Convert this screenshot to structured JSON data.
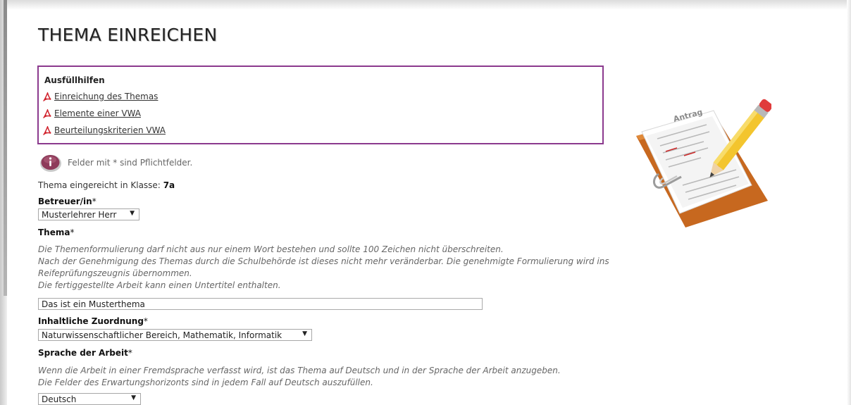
{
  "page": {
    "title": "THEMA EINREICHEN"
  },
  "help": {
    "title": "Ausfüllhilfen",
    "links": [
      "Einreichung des Themas",
      "Elemente einer VWA",
      "Beurteilungskriterien VWA"
    ]
  },
  "info": {
    "text": "Felder mit * sind Pflichtfelder.",
    "icon": "info-icon"
  },
  "klasse": {
    "label": "Thema eingereicht in Klasse:",
    "value": "7a"
  },
  "fields": {
    "betreuer": {
      "label": "Betreuer/in",
      "required_mark": "*",
      "value": "Musterlehrer Herr"
    },
    "thema": {
      "label": "Thema",
      "required_mark": "*",
      "hint_lines": [
        "Die Themenformulierung darf nicht aus nur einem Wort bestehen und sollte 100 Zeichen nicht überschreiten.",
        "Nach der Genehmigung des Themas durch die Schulbehörde ist dieses nicht mehr veränderbar. Die genehmigte Formulierung wird ins",
        "Reifeprüfungszeugnis übernommen.",
        "Die fertiggestellte Arbeit kann einen Untertitel enthalten."
      ],
      "value": "Das ist ein Musterthema"
    },
    "zuordnung": {
      "label": "Inhaltliche Zuordnung",
      "required_mark": "*",
      "value": "Naturwissenschaftlicher Bereich, Mathematik, Informatik"
    },
    "sprache": {
      "label": "Sprache der Arbeit",
      "required_mark": "*",
      "hint_lines": [
        "Wenn die Arbeit in einer Fremdsprache verfasst wird, ist das Thema auf Deutsch und in der Sprache der Arbeit anzugeben.",
        "Die Felder des Erwartungshorizonts sind in jedem Fall auf Deutsch auszufüllen."
      ],
      "value": "Deutsch"
    }
  },
  "illustration": {
    "word": "Antrag",
    "icon": "document-pencil-illustration"
  },
  "colors": {
    "helpbox_border": "#8b3a8e",
    "pdf_red": "#d0202a",
    "info_icon": "#8e3a5a"
  }
}
